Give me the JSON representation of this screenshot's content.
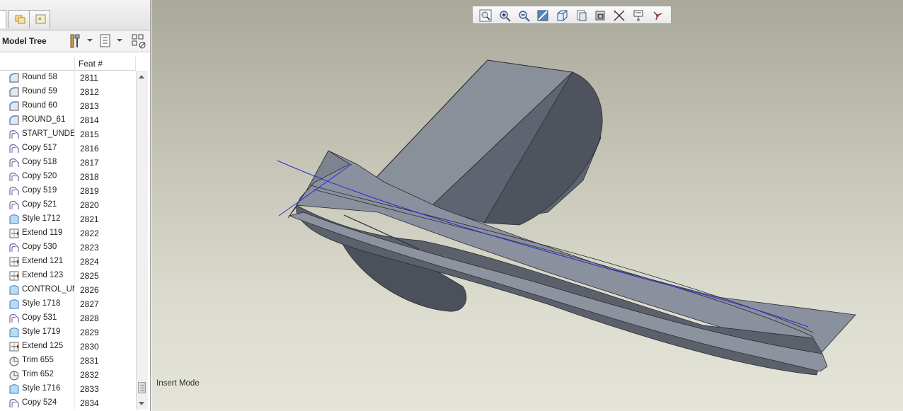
{
  "tree_panel": {
    "title": "Model Tree",
    "column_header": "Feat #",
    "rows": [
      {
        "name": "Round 58",
        "feat": "2811",
        "icon": "round-icon"
      },
      {
        "name": "Round 59",
        "feat": "2812",
        "icon": "round-icon"
      },
      {
        "name": "Round 60",
        "feat": "2813",
        "icon": "round-icon"
      },
      {
        "name": "ROUND_61",
        "feat": "2814",
        "icon": "round-icon"
      },
      {
        "name": "START_UNDER",
        "feat": "2815",
        "icon": "copy-surface-icon"
      },
      {
        "name": "Copy 517",
        "feat": "2816",
        "icon": "copy-surface-icon"
      },
      {
        "name": "Copy 518",
        "feat": "2817",
        "icon": "copy-surface-icon"
      },
      {
        "name": "Copy 520",
        "feat": "2818",
        "icon": "copy-surface-icon"
      },
      {
        "name": "Copy 519",
        "feat": "2819",
        "icon": "copy-surface-icon"
      },
      {
        "name": "Copy 521",
        "feat": "2820",
        "icon": "copy-surface-icon"
      },
      {
        "name": "Style 1712",
        "feat": "2821",
        "icon": "style-icon"
      },
      {
        "name": "Extend 119",
        "feat": "2822",
        "icon": "extend-icon"
      },
      {
        "name": "Copy 530",
        "feat": "2823",
        "icon": "copy-surface-icon"
      },
      {
        "name": "Extend 121",
        "feat": "2824",
        "icon": "extend-icon"
      },
      {
        "name": "Extend 123",
        "feat": "2825",
        "icon": "extend-icon"
      },
      {
        "name": "CONTROL_UND",
        "feat": "2826",
        "icon": "style-icon"
      },
      {
        "name": "Style 1718",
        "feat": "2827",
        "icon": "style-icon"
      },
      {
        "name": "Copy 531",
        "feat": "2828",
        "icon": "copy-surface-icon"
      },
      {
        "name": "Style 1719",
        "feat": "2829",
        "icon": "style-icon"
      },
      {
        "name": "Extend 125",
        "feat": "2830",
        "icon": "extend-icon"
      },
      {
        "name": "Trim 655",
        "feat": "2831",
        "icon": "trim-icon"
      },
      {
        "name": "Trim 652",
        "feat": "2832",
        "icon": "trim-icon"
      },
      {
        "name": "Style 1716",
        "feat": "2833",
        "icon": "style-icon"
      },
      {
        "name": "Copy 524",
        "feat": "2834",
        "icon": "copy-surface-icon"
      }
    ]
  },
  "viewport": {
    "status_text": "Insert Mode",
    "toolbar_icons": [
      "refit-icon",
      "zoom-in-icon",
      "zoom-out-icon",
      "repaint-icon",
      "display-style-icon",
      "saved-views-icon",
      "layers-icon",
      "datum-display-icon",
      "annotation-icon",
      "spin-center-icon"
    ]
  },
  "colors": {
    "curve": "#2b2bd8",
    "model_surface": "#7e8591",
    "viewport_top": "#a9a89a",
    "viewport_bottom": "#e4e4da"
  }
}
